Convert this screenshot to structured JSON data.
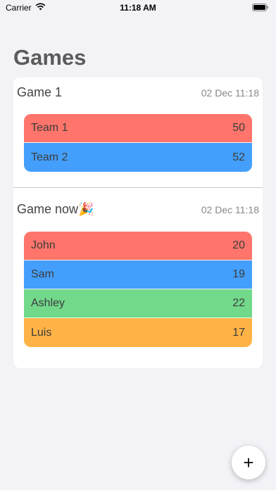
{
  "status_bar": {
    "carrier": "Carrier",
    "time": "11:18 AM",
    "wifi_icon": "wifi-icon",
    "battery_icon": "battery-icon"
  },
  "page": {
    "title": "Games"
  },
  "colors": {
    "red": "#ff756b",
    "blue": "#449ffc",
    "green": "#72d98b",
    "orange": "#ffb347",
    "background": "#f2f2f7"
  },
  "games": [
    {
      "name": "Game 1",
      "date": "02 Dec 11:18",
      "players": [
        {
          "name": "Team 1",
          "score": "50",
          "color": "#ff756b"
        },
        {
          "name": "Team 2",
          "score": "52",
          "color": "#449ffc"
        }
      ]
    },
    {
      "name": "Game now🎉",
      "date": "02 Dec 11:18",
      "players": [
        {
          "name": "John",
          "score": "20",
          "color": "#ff756b"
        },
        {
          "name": "Sam",
          "score": "19",
          "color": "#449ffc"
        },
        {
          "name": "Ashley",
          "score": "22",
          "color": "#72d98b"
        },
        {
          "name": "Luis",
          "score": "17",
          "color": "#ffb347"
        }
      ]
    }
  ],
  "fab": {
    "icon": "plus-icon",
    "label": "+"
  }
}
